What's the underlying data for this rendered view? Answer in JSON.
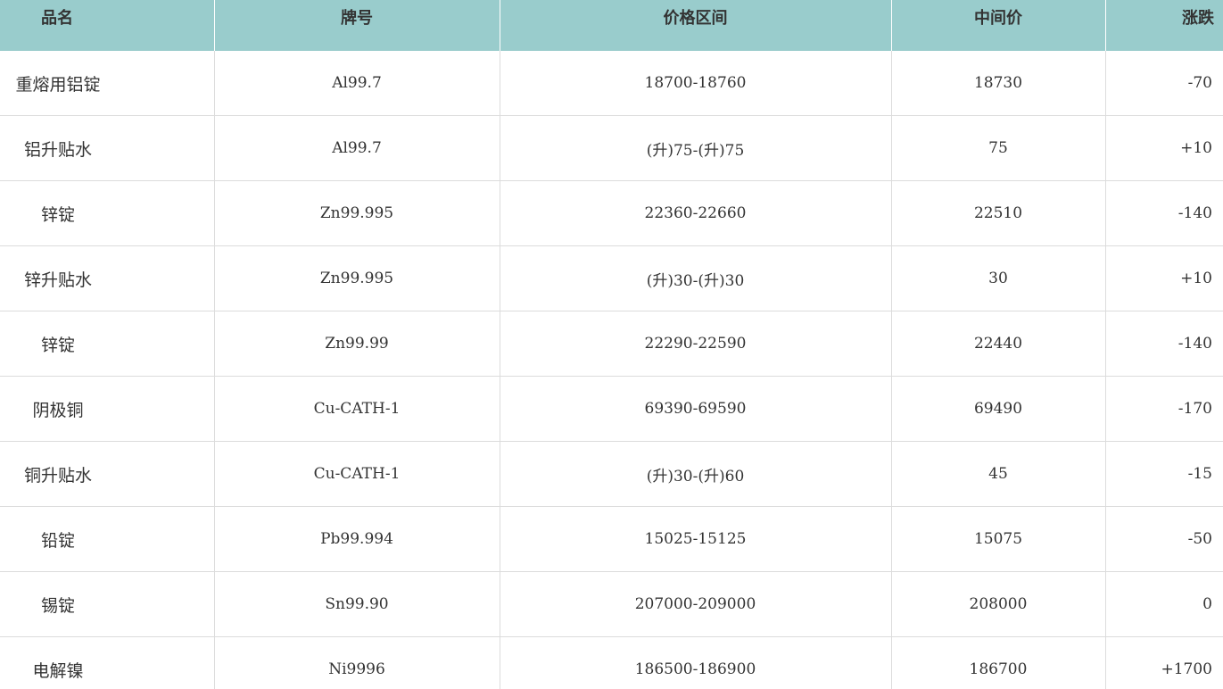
{
  "table": {
    "headers": [
      "品名",
      "牌号",
      "价格区间",
      "中间价",
      "涨跌"
    ],
    "rows": [
      [
        "重熔用铝锭",
        "Al99.7",
        "18700-18760",
        "18730",
        "-70"
      ],
      [
        "铝升贴水",
        "Al99.7",
        "(升)75-(升)75",
        "75",
        "+10"
      ],
      [
        "锌锭",
        "Zn99.995",
        "22360-22660",
        "22510",
        "-140"
      ],
      [
        "锌升贴水",
        "Zn99.995",
        "(升)30-(升)30",
        "30",
        "+10"
      ],
      [
        "锌锭",
        "Zn99.99",
        "22290-22590",
        "22440",
        "-140"
      ],
      [
        "阴极铜",
        "Cu-CATH-1",
        "69390-69590",
        "69490",
        "-170"
      ],
      [
        "铜升贴水",
        "Cu-CATH-1",
        "(升)30-(升)60",
        "45",
        "-15"
      ],
      [
        "铅锭",
        "Pb99.994",
        "15025-15125",
        "15075",
        "-50"
      ],
      [
        "锡锭",
        "Sn99.90",
        "207000-209000",
        "208000",
        "0"
      ],
      [
        "电解镍",
        "Ni9996",
        "186500-186900",
        "186700",
        "+1700"
      ]
    ],
    "colors": {
      "header_bg": "#99cccc",
      "grid": "#dcdcdc",
      "text": "#333333"
    }
  }
}
